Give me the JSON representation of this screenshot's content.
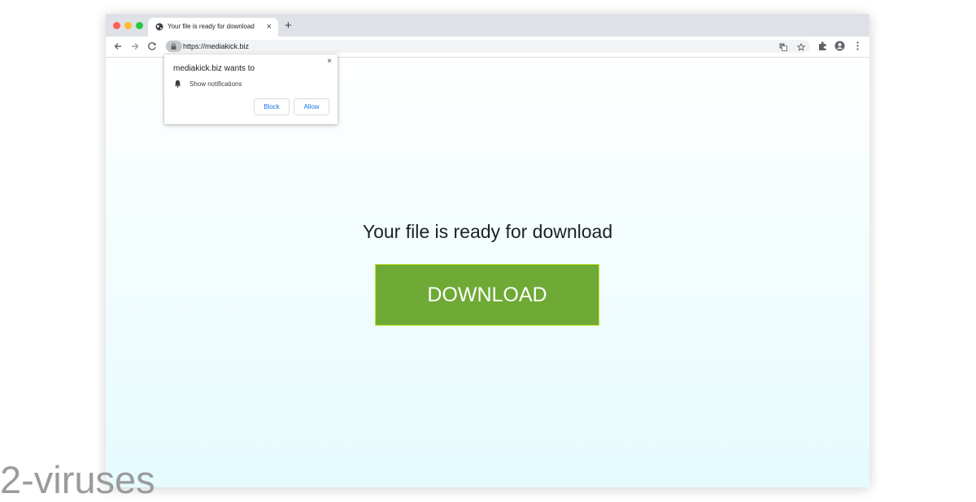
{
  "browser": {
    "tab": {
      "title": "Your file is ready for download",
      "close_glyph": "×",
      "icon": "globe-icon"
    },
    "new_tab_glyph": "+",
    "address_bar": {
      "url": "https://mediakick.biz",
      "security_icon": "lock-icon"
    },
    "toolbar_icons": [
      "back-arrow-icon",
      "forward-arrow-icon",
      "reload-icon",
      "translate-icon",
      "star-icon",
      "extensions-icon",
      "profile-icon",
      "kebab-menu-icon"
    ]
  },
  "permission_popup": {
    "title": "mediakick.biz wants to",
    "permission": "Show notifications",
    "permission_icon": "bell-icon",
    "close_glyph": "×",
    "block_label": "Block",
    "allow_label": "Allow"
  },
  "page": {
    "headline": "Your file is ready for download",
    "download_label": "DOWNLOAD",
    "button_color": "#6eaa35"
  },
  "watermark": {
    "text": "2-viruses"
  }
}
